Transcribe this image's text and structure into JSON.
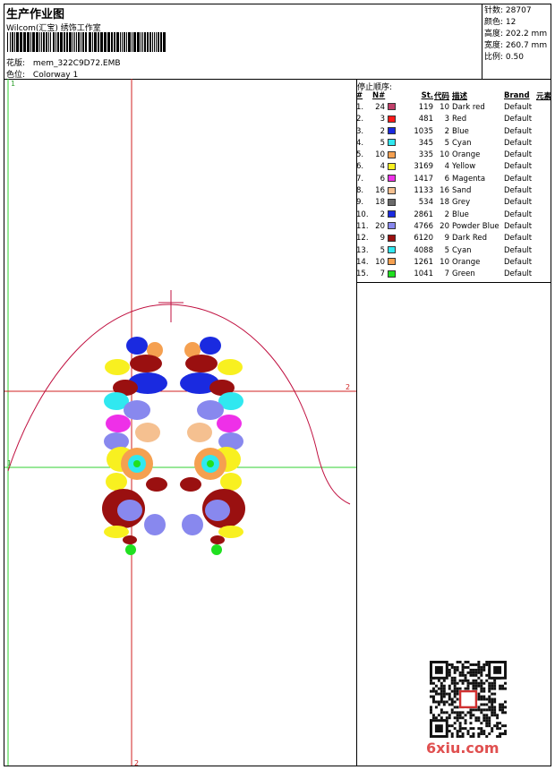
{
  "header": {
    "title": "生产作业图",
    "company": "Wilcom(汇宝) 绣饰工作室",
    "design_label": "花版:",
    "design_file": "mem_322C9D72.EMB",
    "colorway_label": "色位:",
    "colorway": "Colorway 1"
  },
  "stats": [
    {
      "label": "针数:",
      "value": "28707"
    },
    {
      "label": "颜色:",
      "value": "12"
    },
    {
      "label": "高度:",
      "value": "202.2 mm"
    },
    {
      "label": "宽度:",
      "value": "260.7 mm"
    },
    {
      "label": "比例:",
      "value": "0.50"
    }
  ],
  "sequence": {
    "title": "停止顺序:",
    "headers": [
      "#",
      "N#",
      "St.",
      "代码",
      "描述",
      "Brand",
      "元素"
    ],
    "rows": [
      {
        "idx": "1.",
        "n": "24",
        "color": "#c0406a",
        "st": "119",
        "code": "10",
        "desc": "Dark red",
        "brand": "Default"
      },
      {
        "idx": "2.",
        "n": "3",
        "color": "#ff1a1a",
        "st": "481",
        "code": "3",
        "desc": "Red",
        "brand": "Default"
      },
      {
        "idx": "3.",
        "n": "2",
        "color": "#1a2ae0",
        "st": "1035",
        "code": "2",
        "desc": "Blue",
        "brand": "Default"
      },
      {
        "idx": "4.",
        "n": "5",
        "color": "#30e8f0",
        "st": "345",
        "code": "5",
        "desc": "Cyan",
        "brand": "Default"
      },
      {
        "idx": "5.",
        "n": "10",
        "color": "#f5a050",
        "st": "335",
        "code": "10",
        "desc": "Orange",
        "brand": "Default"
      },
      {
        "idx": "6.",
        "n": "4",
        "color": "#f8f020",
        "st": "3169",
        "code": "4",
        "desc": "Yellow",
        "brand": "Default"
      },
      {
        "idx": "7.",
        "n": "6",
        "color": "#ee30e8",
        "st": "1417",
        "code": "6",
        "desc": "Magenta",
        "brand": "Default"
      },
      {
        "idx": "8.",
        "n": "16",
        "color": "#f5c090",
        "st": "1133",
        "code": "16",
        "desc": "Sand",
        "brand": "Default"
      },
      {
        "idx": "9.",
        "n": "18",
        "color": "#6a6a6a",
        "st": "534",
        "code": "18",
        "desc": "Grey",
        "brand": "Default"
      },
      {
        "idx": "10.",
        "n": "2",
        "color": "#1a2ae0",
        "st": "2861",
        "code": "2",
        "desc": "Blue",
        "brand": "Default"
      },
      {
        "idx": "11.",
        "n": "20",
        "color": "#8888ee",
        "st": "4766",
        "code": "20",
        "desc": "Powder Blue",
        "brand": "Default"
      },
      {
        "idx": "12.",
        "n": "9",
        "color": "#9a1010",
        "st": "6120",
        "code": "9",
        "desc": "Dark Red",
        "brand": "Default"
      },
      {
        "idx": "13.",
        "n": "5",
        "color": "#30e8f0",
        "st": "4088",
        "code": "5",
        "desc": "Cyan",
        "brand": "Default"
      },
      {
        "idx": "14.",
        "n": "10",
        "color": "#f5a050",
        "st": "1261",
        "code": "10",
        "desc": "Orange",
        "brand": "Default"
      },
      {
        "idx": "15.",
        "n": "7",
        "color": "#20e020",
        "st": "1041",
        "code": "7",
        "desc": "Green",
        "brand": "Default"
      }
    ]
  },
  "canvas": {
    "marker_1_top": "1",
    "marker_1_left": "1",
    "marker_2_right": "2",
    "marker_2_bottom": "2"
  },
  "watermark": "6xiu.com"
}
